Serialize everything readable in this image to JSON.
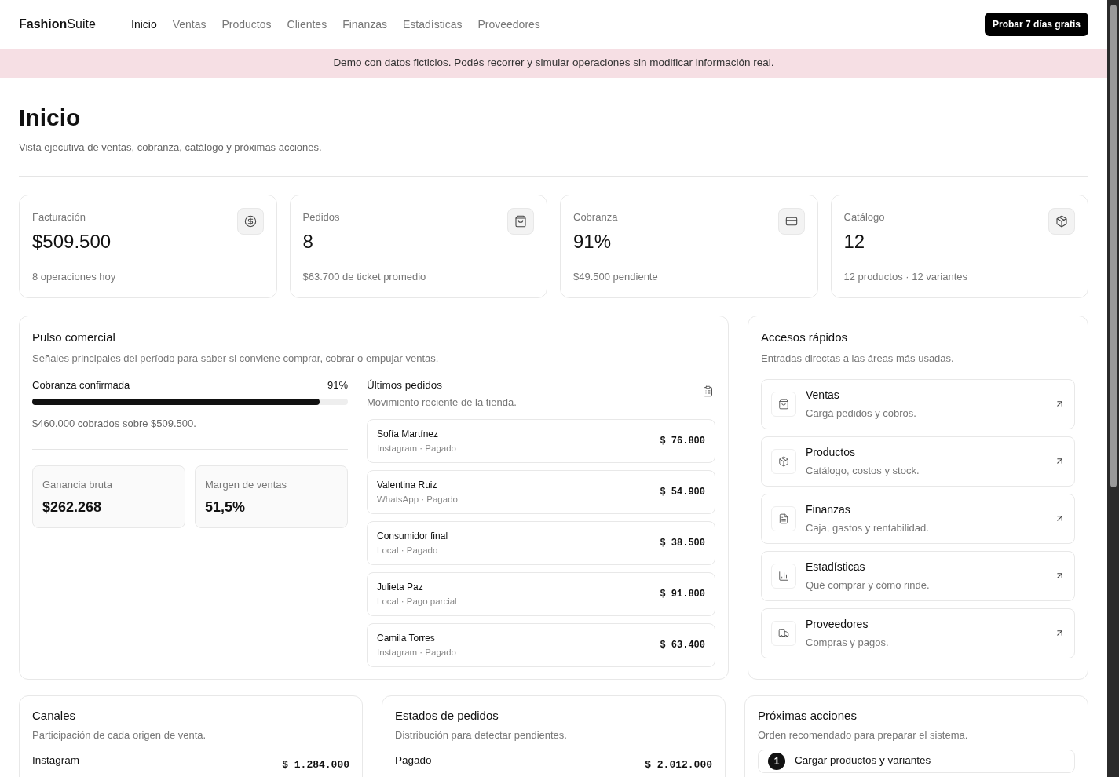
{
  "brand": {
    "bold": "Fashion",
    "light": "Suite"
  },
  "nav": [
    {
      "label": "Inicio",
      "selected": true
    },
    {
      "label": "Ventas",
      "selected": false
    },
    {
      "label": "Productos",
      "selected": false
    },
    {
      "label": "Clientes",
      "selected": false
    },
    {
      "label": "Finanzas",
      "selected": false
    },
    {
      "label": "Estadísticas",
      "selected": false
    },
    {
      "label": "Proveedores",
      "selected": false
    }
  ],
  "trial_button": "Probar 7 días gratis",
  "banner": "Demo con datos ficticios. Podés recorrer y simular operaciones sin modificar información real.",
  "page": {
    "title": "Inicio",
    "subtitle": "Vista ejecutiva de ventas, cobranza, catálogo y próximas acciones."
  },
  "stats": [
    {
      "label": "Facturación",
      "value": "$509.500",
      "note": "8 operaciones hoy"
    },
    {
      "label": "Pedidos",
      "value": "8",
      "note": "$63.700 de ticket promedio"
    },
    {
      "label": "Cobranza",
      "value": "91%",
      "note": "$49.500 pendiente"
    },
    {
      "label": "Catálogo",
      "value": "12",
      "note": "12 productos · 12 variantes"
    }
  ],
  "pulse": {
    "title": "Pulso comercial",
    "subtitle": "Señales principales del período para saber si conviene comprar, cobrar o empujar ventas.",
    "progress": {
      "label": "Cobranza confirmada",
      "reading": "91%",
      "level": 0.91,
      "caption": "$460.000 cobrados sobre $509.500."
    },
    "metrics": [
      {
        "label": "Ganancia bruta",
        "value": "$262.268"
      },
      {
        "label": "Margen de ventas",
        "value": "51,5%"
      }
    ],
    "orders": {
      "title": "Últimos pedidos",
      "subtitle": "Movimiento reciente de la tienda.",
      "items": [
        {
          "name": "Sofía Martínez",
          "detail": "Instagram · Pagado",
          "amount": "$ 76.800"
        },
        {
          "name": "Valentina Ruiz",
          "detail": "WhatsApp · Pagado",
          "amount": "$ 54.900"
        },
        {
          "name": "Consumidor final",
          "detail": "Local · Pagado",
          "amount": "$ 38.500"
        },
        {
          "name": "Julieta Paz",
          "detail": "Local · Pago parcial",
          "amount": "$ 91.800"
        },
        {
          "name": "Camila Torres",
          "detail": "Instagram · Pagado",
          "amount": "$ 63.400"
        }
      ]
    }
  },
  "quick": {
    "title": "Accesos rápidos",
    "subtitle": "Entradas directas a las áreas más usadas.",
    "items": [
      {
        "title": "Ventas",
        "subtitle": "Cargá pedidos y cobros."
      },
      {
        "title": "Productos",
        "subtitle": "Catálogo, costos y stock."
      },
      {
        "title": "Finanzas",
        "subtitle": "Caja, gastos y rentabilidad."
      },
      {
        "title": "Estadísticas",
        "subtitle": "Qué comprar y cómo rinde."
      },
      {
        "title": "Proveedores",
        "subtitle": "Compras y pagos."
      }
    ]
  },
  "bottom": [
    {
      "title": "Canales",
      "subtitle": "Participación de cada origen de venta.",
      "kind": "list",
      "row": {
        "label": "Instagram",
        "amount": "$ 1.284.000"
      }
    },
    {
      "title": "Estados de pedidos",
      "subtitle": "Distribución para detectar pendientes.",
      "kind": "list",
      "row": {
        "label": "Pagado",
        "amount": "$ 2.012.000"
      }
    },
    {
      "title": "Próximas acciones",
      "subtitle": "Orden recomendado para preparar el sistema.",
      "kind": "steps",
      "step": {
        "number": "1",
        "label": "Cargar productos y variantes"
      }
    }
  ]
}
